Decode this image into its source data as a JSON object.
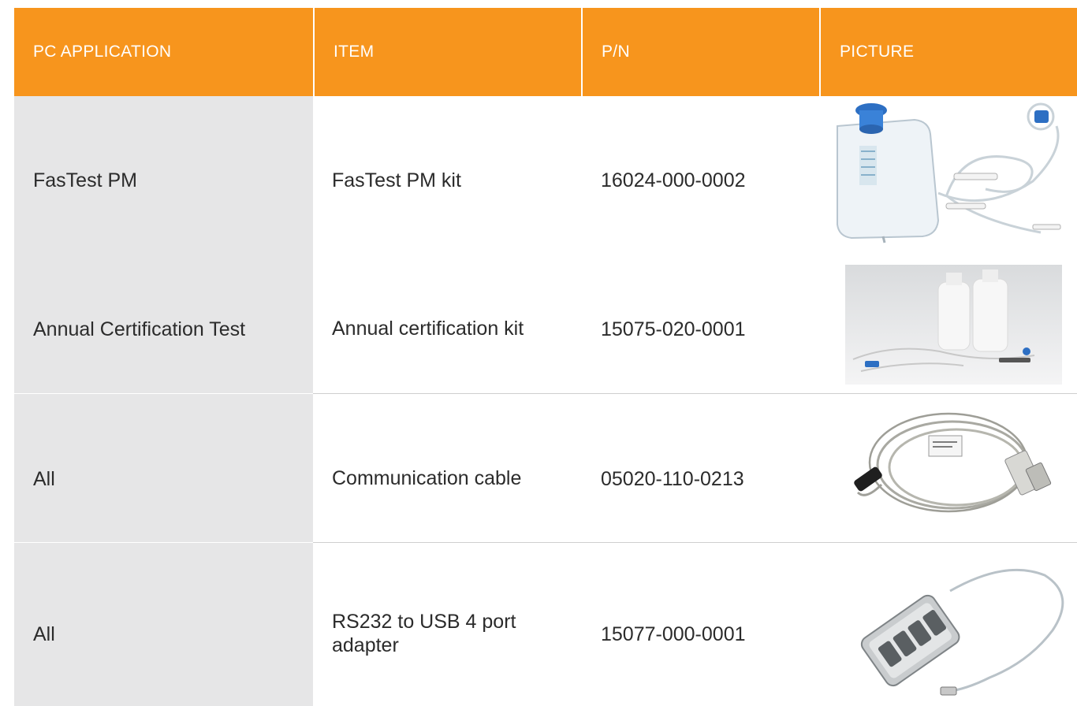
{
  "table": {
    "headers": [
      "PC APPLICATION",
      "ITEM",
      "P/N",
      "PICTURE"
    ],
    "rows": [
      {
        "application": "FasTest PM",
        "item": "FasTest PM kit",
        "pn": "16024-000-0002",
        "picture": "fastest-pm-kit-image"
      },
      {
        "application": "Annual Certification Test",
        "item": "Annual certification kit",
        "pn": "15075-020-0001",
        "picture": "annual-certification-kit-image"
      },
      {
        "application": "All",
        "item": "Communication cable",
        "pn": "05020-110-0213",
        "picture": "communication-cable-image"
      },
      {
        "application": "All",
        "item": "RS232 to USB 4 port adapter",
        "pn": "15077-000-0001",
        "picture": "usb-adapter-image"
      }
    ]
  },
  "colors": {
    "header_bg": "#f7951d",
    "first_col_bg": "#e6e6e7",
    "header_text": "#ffffff"
  }
}
